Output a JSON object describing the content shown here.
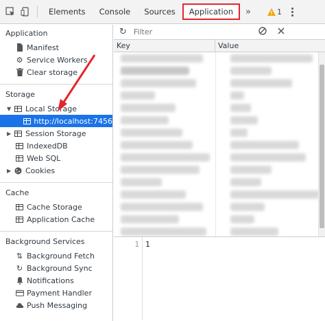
{
  "toolbar": {
    "tabs": [
      {
        "label": "Elements"
      },
      {
        "label": "Console"
      },
      {
        "label": "Sources"
      },
      {
        "label": "Application"
      }
    ],
    "more_label": "»",
    "warning_count": "1"
  },
  "sidebar": {
    "application": {
      "title": "Application",
      "items": [
        "Manifest",
        "Service Workers",
        "Clear storage"
      ]
    },
    "storage": {
      "title": "Storage",
      "local_storage": "Local Storage",
      "local_storage_origin": "http://localhost:7456",
      "session_storage": "Session Storage",
      "indexeddb": "IndexedDB",
      "websql": "Web SQL",
      "cookies": "Cookies"
    },
    "cache": {
      "title": "Cache",
      "items": [
        "Cache Storage",
        "Application Cache"
      ]
    },
    "background": {
      "title": "Background Services",
      "items": [
        "Background Fetch",
        "Background Sync",
        "Notifications",
        "Payment Handler",
        "Push Messaging"
      ]
    }
  },
  "main": {
    "filter_placeholder": "Filter",
    "columns": {
      "key": "Key",
      "value": "Value"
    },
    "editor": {
      "line_number": "1",
      "content": "1"
    }
  },
  "colors": {
    "accent": "#1a73e8",
    "highlight_red": "#e3252d"
  }
}
